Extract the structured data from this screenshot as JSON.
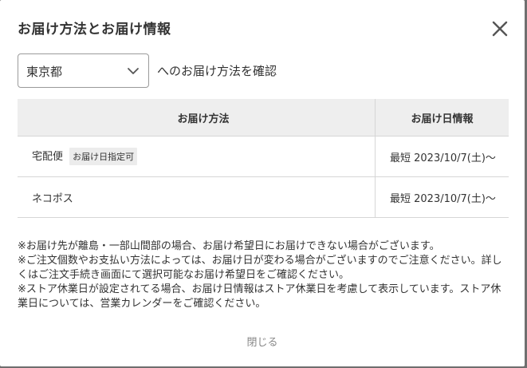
{
  "modal": {
    "title": "お届け方法とお届け情報",
    "close_icon": "close-icon"
  },
  "region": {
    "selected": "東京都",
    "confirm_text": "へのお届け方法を確認"
  },
  "table": {
    "headers": [
      "お届け方法",
      "お届け日情報"
    ],
    "rows": [
      {
        "method": "宅配便",
        "badge": "お届け日指定可",
        "date": "最短 2023/10/7(土)～"
      },
      {
        "method": "ネコポス",
        "badge": "",
        "date": "最短 2023/10/7(土)～"
      }
    ]
  },
  "notes": [
    "※お届け先が離島・一部山間部の場合、お届け希望日にお届けできない場合がございます。",
    "※ご注文個数やお支払い方法によっては、お届け日が変わる場合がございますのでご注意ください。詳しくはご注文手続き画面にて選択可能なお届け希望日をご確認ください。",
    "※ストア休業日が設定されてる場合、お届け日情報はストア休業日を考慮して表示しています。ストア休業日については、営業カレンダーをご確認ください。"
  ],
  "footer": {
    "close_label": "閉じる"
  },
  "colors": {
    "header_bg": "#eeeeee",
    "border": "#d6d6d6",
    "overlay": "#6f6f6f"
  }
}
